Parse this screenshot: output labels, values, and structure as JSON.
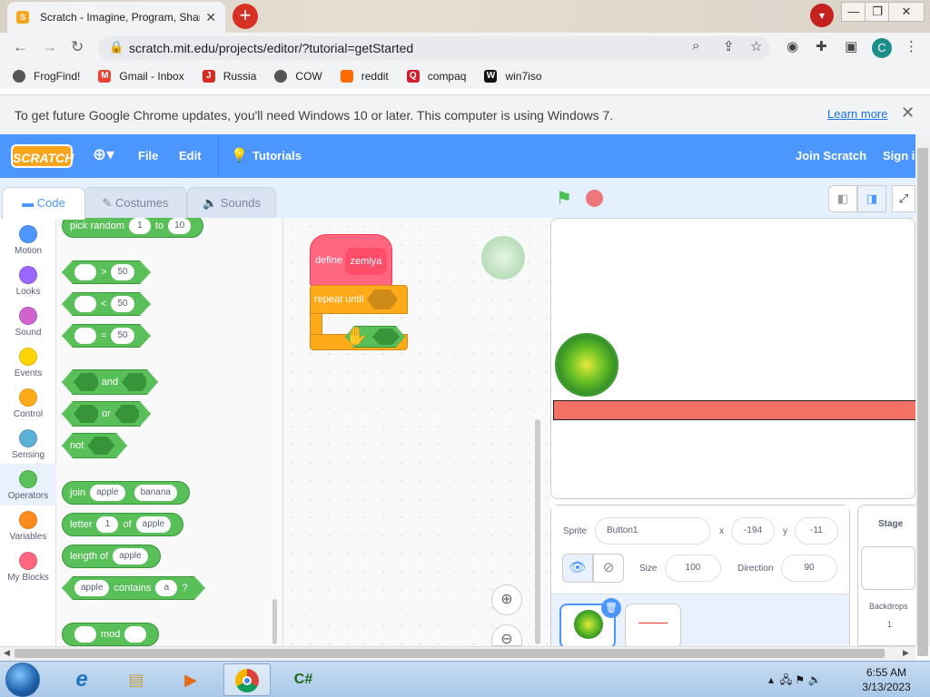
{
  "browser": {
    "tab_title": "Scratch - Imagine, Program, Shar",
    "url": "scratch.mit.edu/projects/editor/?tutorial=getStarted",
    "profile_letter": "C"
  },
  "bookmarks": [
    "FrogFind!",
    "Gmail - Inbox",
    "Russia",
    "COW",
    "reddit",
    "compaq",
    "win7iso"
  ],
  "infobar": {
    "message": "To get future Google Chrome updates, you'll need Windows 10 or later. This computer is using Windows 7.",
    "link": "Learn more"
  },
  "menu": {
    "logo": "SCRATCH",
    "file": "File",
    "edit": "Edit",
    "tutorials": "Tutorials",
    "join": "Join Scratch",
    "signin": "Sign in"
  },
  "editor_tabs": {
    "code": "Code",
    "costumes": "Costumes",
    "sounds": "Sounds"
  },
  "categories": [
    {
      "label": "Motion",
      "color": "#4c97ff"
    },
    {
      "label": "Looks",
      "color": "#9966ff"
    },
    {
      "label": "Sound",
      "color": "#cf63cf"
    },
    {
      "label": "Events",
      "color": "#ffd500"
    },
    {
      "label": "Control",
      "color": "#ffab19"
    },
    {
      "label": "Sensing",
      "color": "#5cb1d6"
    },
    {
      "label": "Operators",
      "color": "#59c059"
    },
    {
      "label": "Variables",
      "color": "#ff8c1a"
    },
    {
      "label": "My Blocks",
      "color": "#ff6680"
    }
  ],
  "palette": {
    "pick_random": {
      "label": "pick random",
      "a": "1",
      "to": "to",
      "b": "10"
    },
    "gt": {
      "op": ">",
      "val": "50"
    },
    "lt": {
      "op": "<",
      "val": "50"
    },
    "eq": {
      "op": "=",
      "val": "50"
    },
    "and": "and",
    "or": "or",
    "not": "not",
    "join": {
      "label": "join",
      "a": "apple",
      "b": "banana"
    },
    "letter": {
      "label": "letter",
      "n": "1",
      "of": "of",
      "word": "apple"
    },
    "length": {
      "label": "length of",
      "word": "apple"
    },
    "contains": {
      "word": "apple",
      "label": "contains",
      "ch": "a",
      "q": "?"
    },
    "mod": "mod"
  },
  "script": {
    "define": "define",
    "proc": "zemlya",
    "repeat": "repeat until"
  },
  "sprite": {
    "label_sprite": "Sprite",
    "name": "Button1",
    "label_x": "x",
    "x": "-194",
    "label_y": "y",
    "y": "-11",
    "label_size": "Size",
    "size": "100",
    "label_direction": "Direction",
    "direction": "90"
  },
  "stage_pane": {
    "title": "Stage",
    "backdrops_label": "Backdrops",
    "backdrops": "1"
  },
  "taskbar": {
    "time": "6:55 AM",
    "date": "3/13/2023"
  }
}
